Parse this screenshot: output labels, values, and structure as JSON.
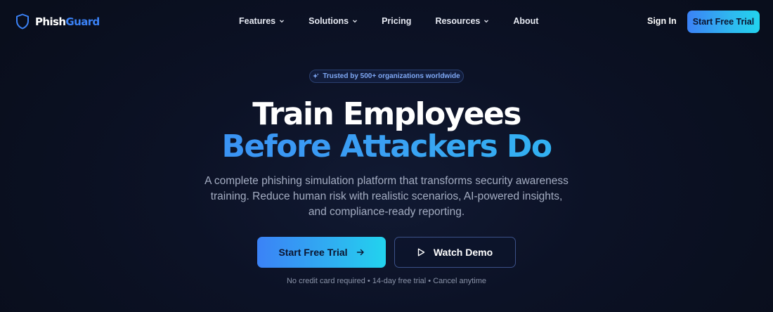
{
  "brand": {
    "name_part1": "Phish",
    "name_part2": "Guard",
    "accent": "#3b82f6",
    "icon": "shield-icon"
  },
  "nav": {
    "items": [
      {
        "label": "Features",
        "has_dropdown": true
      },
      {
        "label": "Solutions",
        "has_dropdown": true
      },
      {
        "label": "Pricing",
        "has_dropdown": false
      },
      {
        "label": "Resources",
        "has_dropdown": true
      },
      {
        "label": "About",
        "has_dropdown": false
      }
    ],
    "sign_in": "Sign In",
    "cta": "Start Free Trial"
  },
  "hero": {
    "badge": "Trusted by 500+ organizations worldwide",
    "badge_icon": "sparkle-icon",
    "title_line1": "Train Employees",
    "title_line2": "Before Attackers Do",
    "subtitle_lines": [
      "A complete phishing simulation platform that transforms security awareness",
      "training. Reduce human risk with realistic scenarios, AI-powered insights,",
      "and compliance-ready reporting."
    ],
    "primary_cta": "Start Free Trial",
    "primary_cta_icon": "arrow-right-icon",
    "secondary_cta": "Watch Demo",
    "secondary_cta_icon": "play-icon",
    "fine_print": "No credit card required • 14-day free trial • Cancel anytime"
  },
  "colors": {
    "background": "#0a0f1f",
    "gradient_start": "#3b82f6",
    "gradient_end": "#22d3ee",
    "muted_text": "#a4adc2"
  }
}
